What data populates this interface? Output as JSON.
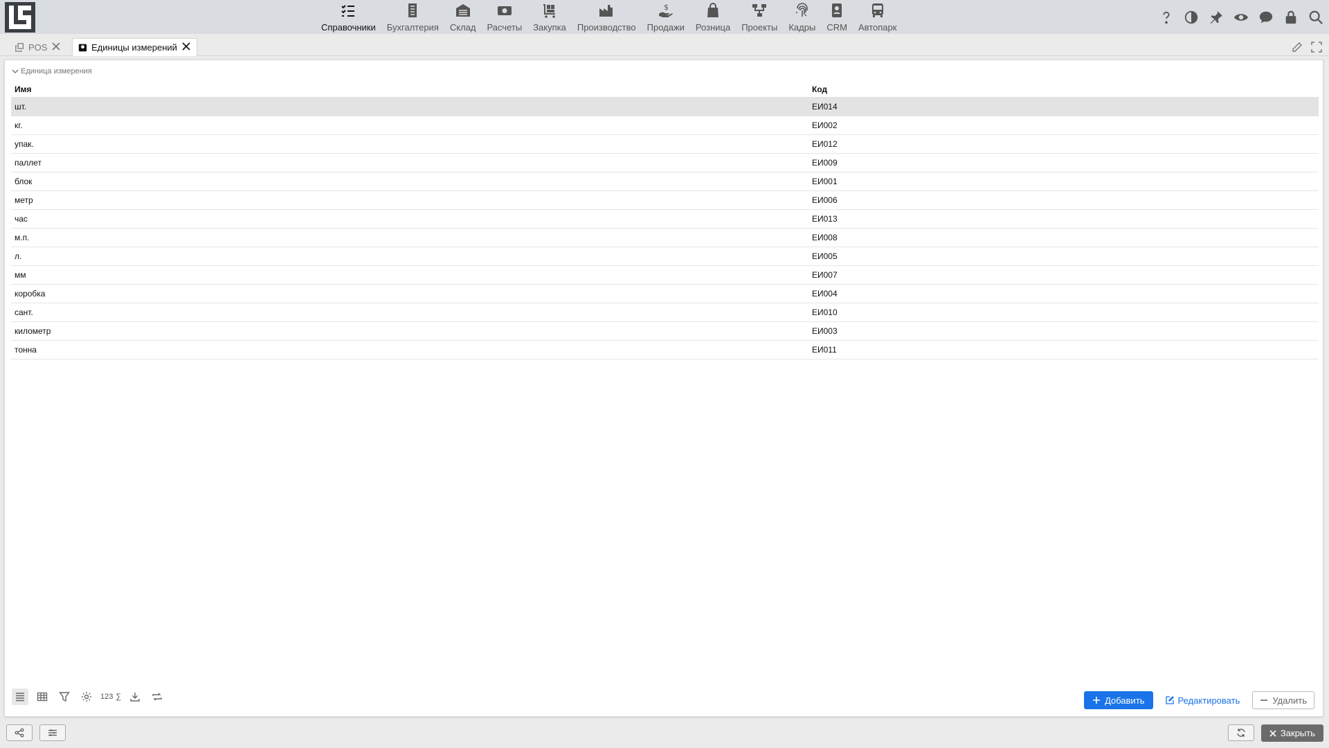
{
  "nav": {
    "items": [
      {
        "label": "Справочники",
        "icon": "list-check-icon"
      },
      {
        "label": "Бухгалтерия",
        "icon": "ledger-icon"
      },
      {
        "label": "Склад",
        "icon": "warehouse-icon"
      },
      {
        "label": "Расчеты",
        "icon": "money-icon"
      },
      {
        "label": "Закупка",
        "icon": "cart-icon"
      },
      {
        "label": "Производство",
        "icon": "factory-icon"
      },
      {
        "label": "Продажи",
        "icon": "hand-money-icon"
      },
      {
        "label": "Розница",
        "icon": "bag-icon"
      },
      {
        "label": "Проекты",
        "icon": "project-tree-icon"
      },
      {
        "label": "Кадры",
        "icon": "fingerprint-icon"
      },
      {
        "label": "CRM",
        "icon": "contact-card-icon"
      },
      {
        "label": "Автопарк",
        "icon": "bus-icon"
      }
    ]
  },
  "tabs": [
    {
      "label": "POS"
    },
    {
      "label": "Единицы измерений"
    }
  ],
  "group": {
    "title": "Единица измерения"
  },
  "table": {
    "columns": [
      "Имя",
      "Код"
    ],
    "rows": [
      [
        "шт.",
        "ЕИ014"
      ],
      [
        "кг.",
        "ЕИ002"
      ],
      [
        "упак.",
        "ЕИ012"
      ],
      [
        "паллет",
        "ЕИ009"
      ],
      [
        "блок",
        "ЕИ001"
      ],
      [
        "метр",
        "ЕИ006"
      ],
      [
        "час",
        "ЕИ013"
      ],
      [
        "м.п.",
        "ЕИ008"
      ],
      [
        "л.",
        "ЕИ005"
      ],
      [
        "мм",
        "ЕИ007"
      ],
      [
        "коробка",
        "ЕИ004"
      ],
      [
        "сант.",
        "ЕИ010"
      ],
      [
        "километр",
        "ЕИ003"
      ],
      [
        "тонна",
        "ЕИ011"
      ]
    ]
  },
  "toolbar": {
    "number_label": "123",
    "sum_label": "∑"
  },
  "actions": {
    "add": "Добавить",
    "edit": "Редактировать",
    "delete": "Удалить"
  },
  "footer": {
    "close": "Закрыть"
  },
  "colors": {
    "accent": "#1a73e8",
    "topbar": "#d9dce0",
    "selected_row": "#e3e3e3"
  }
}
